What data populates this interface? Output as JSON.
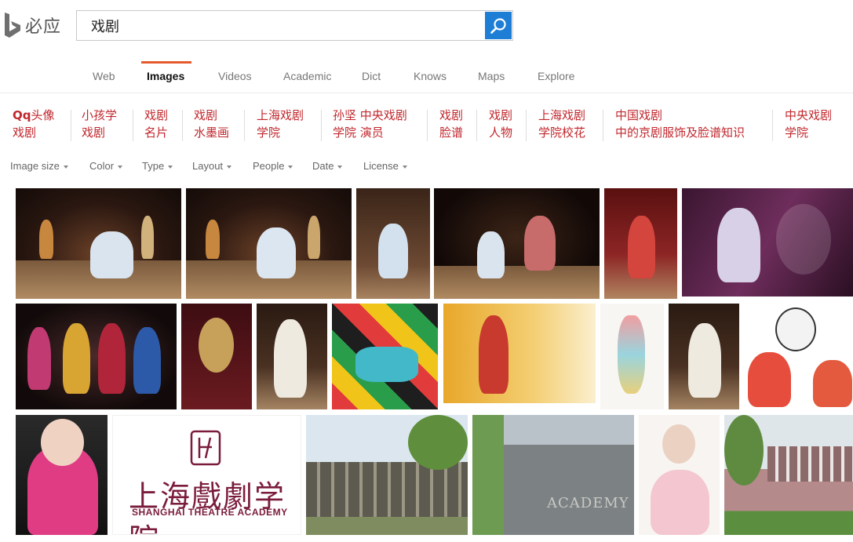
{
  "brand": {
    "name": "必应"
  },
  "search": {
    "query": "戏剧"
  },
  "tabs": [
    {
      "label": "Web"
    },
    {
      "label": "Images"
    },
    {
      "label": "Videos"
    },
    {
      "label": "Academic"
    },
    {
      "label": "Dict"
    },
    {
      "label": "Knows"
    },
    {
      "label": "Maps"
    },
    {
      "label": "Explore"
    }
  ],
  "active_tab": "Images",
  "accent_color": "#e45a2e",
  "related_searches": [
    {
      "line1_bold": "Qq",
      "line1": "头像",
      "line2": "戏剧"
    },
    {
      "line1_bold": "",
      "line1": "小孩学",
      "line2": "戏剧"
    },
    {
      "line1_bold": "",
      "line1": "戏剧",
      "line2": "名片"
    },
    {
      "line1_bold": "",
      "line1": "戏剧",
      "line2": "水墨画"
    },
    {
      "line1_bold": "",
      "line1": "上海戏剧",
      "line2": "学院"
    },
    {
      "line1_bold": "",
      "line1": "孙坚 中央戏剧",
      "line2": "学院 演员"
    },
    {
      "line1_bold": "",
      "line1": "戏剧",
      "line2": "脸谱"
    },
    {
      "line1_bold": "",
      "line1": "戏剧",
      "line2": "人物"
    },
    {
      "line1_bold": "",
      "line1": "上海戏剧",
      "line2": "学院校花"
    },
    {
      "line1_bold": "",
      "line1": "中国戏剧",
      "line2": "中的京剧服饰及脸谱知识"
    },
    {
      "line1_bold": "",
      "line1": "中央戏剧",
      "line2": "学院"
    }
  ],
  "filters": [
    {
      "label": "Image size"
    },
    {
      "label": "Color"
    },
    {
      "label": "Type"
    },
    {
      "label": "Layout"
    },
    {
      "label": "People"
    },
    {
      "label": "Date"
    },
    {
      "label": "License"
    }
  ],
  "images": {
    "academy_logo": {
      "title_cn": "上海戲劇学院",
      "title_en": "SHANGHAI THEATRE ACADEMY"
    },
    "academy_sign_text": "ACADEMY"
  }
}
